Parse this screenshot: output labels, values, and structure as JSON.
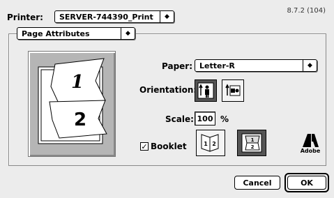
{
  "printer": {
    "label": "Printer:",
    "selected": "SERVER-744390_Print"
  },
  "version": "8.7.2 (104)",
  "panel_menu": {
    "selected": "Page Attributes"
  },
  "preview": {
    "page1": "1",
    "page2": "2"
  },
  "paper": {
    "label": "Paper:",
    "selected": "Letter-R"
  },
  "orientation": {
    "label": "Orientation:",
    "options": [
      {
        "name": "portrait",
        "selected": true
      },
      {
        "name": "landscape",
        "selected": false
      }
    ]
  },
  "scale": {
    "label": "Scale:",
    "value": "100",
    "unit": "%"
  },
  "booklet": {
    "label": "Booklet",
    "checked": true,
    "options": [
      {
        "name": "left-binding",
        "selected": false,
        "pages": "1 2"
      },
      {
        "name": "top-binding",
        "selected": true,
        "pages": "1 2"
      }
    ]
  },
  "logo": {
    "text": "Adobe"
  },
  "buttons": {
    "cancel": "Cancel",
    "ok": "OK"
  }
}
